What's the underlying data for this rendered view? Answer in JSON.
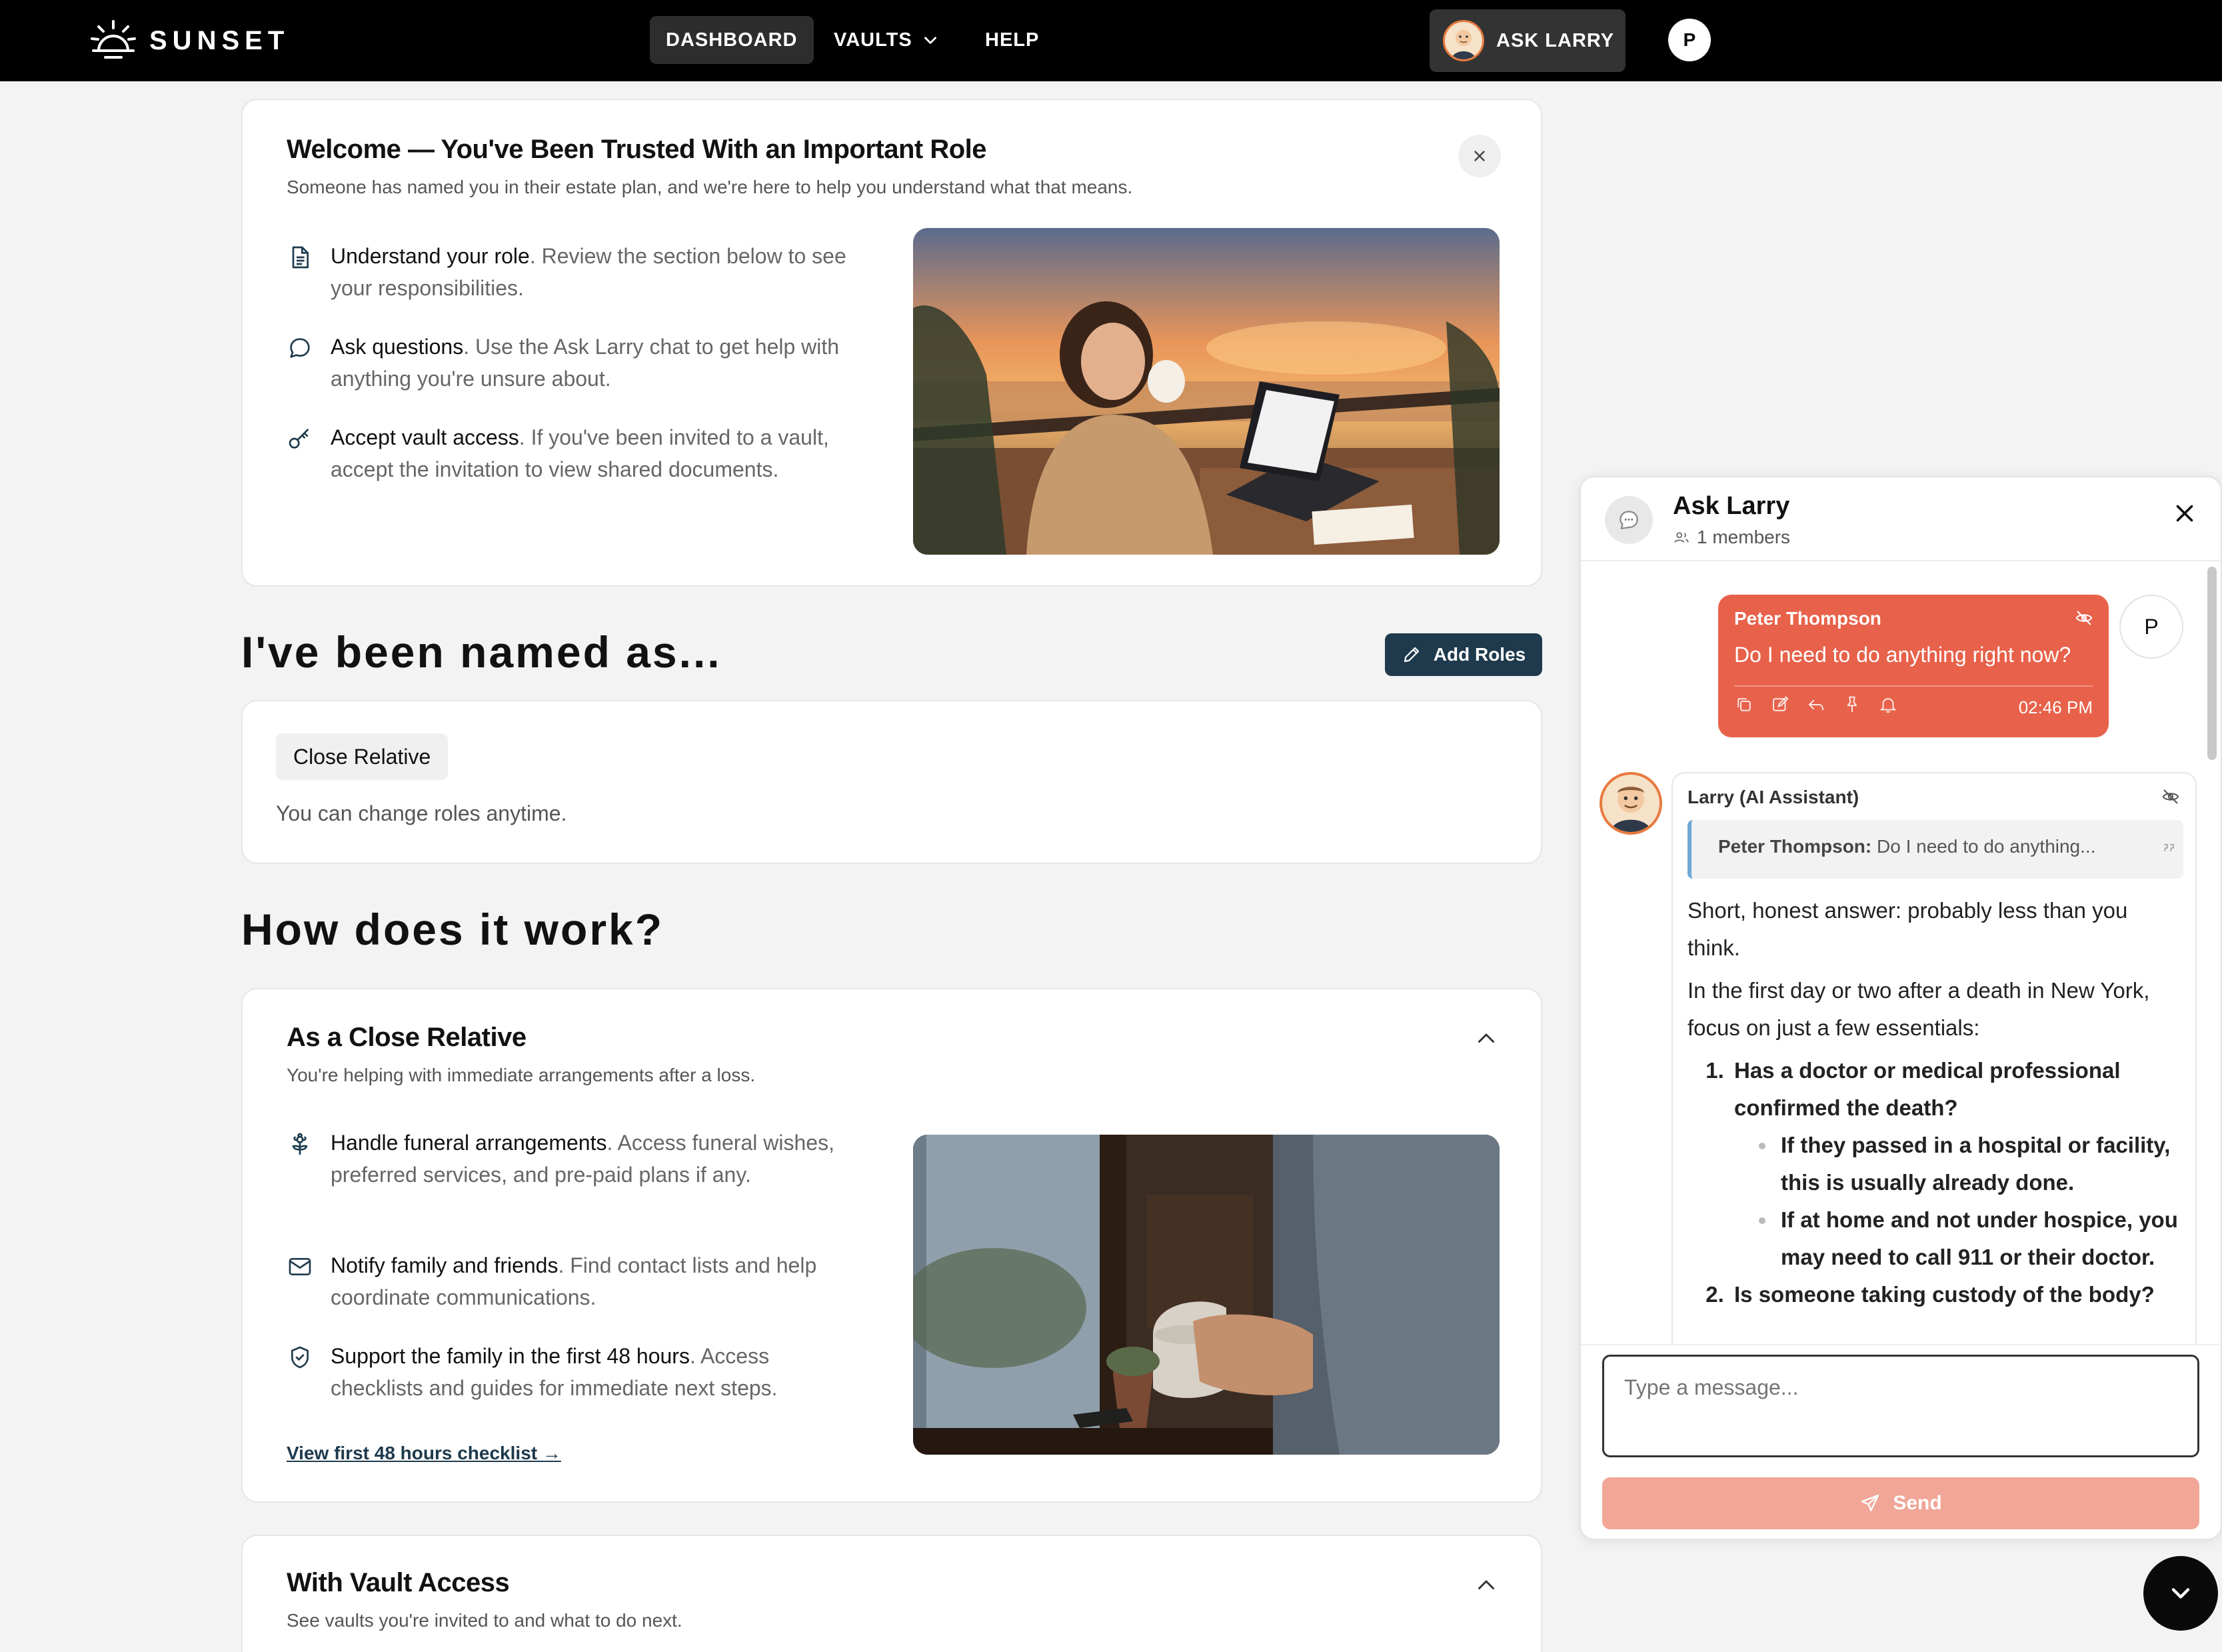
{
  "nav": {
    "brand": "SUNSET",
    "links": [
      "DASHBOARD",
      "VAULTS",
      "HELP"
    ],
    "ask_larry": "ASK LARRY",
    "user_initial": "P"
  },
  "welcome": {
    "title": "Welcome — You've Been Trusted With an Important Role",
    "subtitle": "Someone has named you in their estate plan, and we're here to help you understand what that means.",
    "close_icon": "close-icon",
    "items": [
      {
        "icon": "document-icon",
        "bold": "Understand your role",
        "text": ". Review the section below to see your responsibilities."
      },
      {
        "icon": "chat-bubble-icon",
        "bold": "Ask questions",
        "text": ". Use the Ask Larry chat to get help with anything you're unsure about."
      },
      {
        "icon": "key-icon",
        "bold": "Accept vault access",
        "text": ". If you've been invited to a vault, accept the invitation to view shared documents."
      }
    ]
  },
  "named_as": {
    "heading": "I've been named as...",
    "add_roles": "Add Roles",
    "role_chip": "Close Relative",
    "note": "You can change roles anytime."
  },
  "how": {
    "heading": "How does it work?",
    "relative": {
      "title": "As a Close Relative",
      "subtitle": "You're helping with immediate arrangements after a loss.",
      "items": [
        {
          "icon": "flower-icon",
          "bold": "Handle funeral arrangements",
          "text": ". Access funeral wishes, preferred services, and pre-paid plans if any."
        },
        {
          "icon": "mail-icon",
          "bold": "Notify family and friends",
          "text": ". Find contact lists and help coordinate communications."
        },
        {
          "icon": "shield-check-icon",
          "bold": "Support the family in the first 48 hours",
          "text": ". Access checklists and guides for immediate next steps."
        }
      ],
      "link": "View first 48 hours checklist →"
    },
    "vault": {
      "title": "With Vault Access",
      "subtitle": "See vaults you're invited to and what to do next."
    }
  },
  "chat": {
    "title": "Ask Larry",
    "members": "1 members",
    "user_msg": {
      "name": "Peter Thompson",
      "text": "Do I need to do anything right now?",
      "time": "02:46 PM",
      "avatar": "P"
    },
    "larry_msg": {
      "name": "Larry (AI Assistant)",
      "quote_name": "Peter Thompson:",
      "quote_text": "Do I need to do anything...",
      "p1": "Short, honest answer: probably less than you think.",
      "p2": "In the first day or two after a death in New York, focus on just a few essentials:",
      "li1": "Has a doctor or medical professional confirmed the death?",
      "li1_sub1": "If they passed in a hospital or facility, this is usually already done.",
      "li1_sub2": "If at home and not under hospice, you may need to call 911 or their doctor.",
      "li2": "Is someone taking custody of the body?"
    },
    "input_placeholder": "Type a message...",
    "send": "Send"
  }
}
